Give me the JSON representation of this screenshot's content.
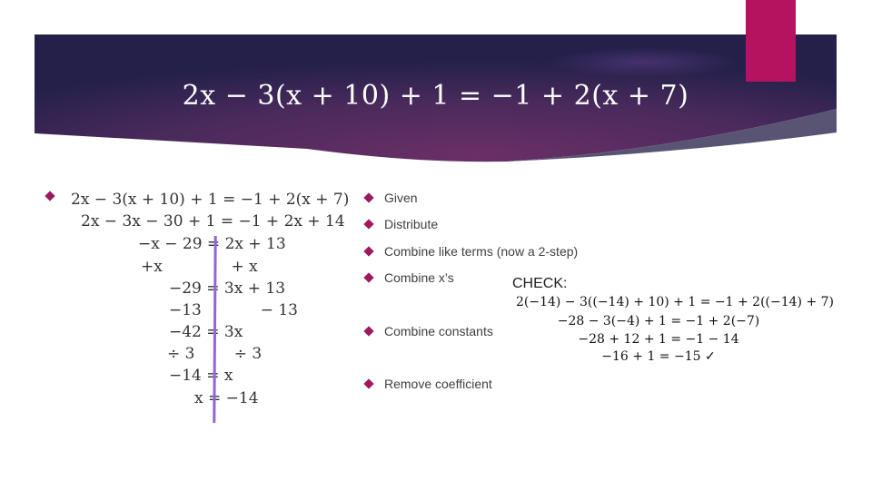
{
  "slide": {
    "title_equation": "2x − 3(x + 10) + 1 = −1 + 2(x + 7)",
    "colors": {
      "banner_dark": "#24204a",
      "banner_mid": "#6a2f66",
      "accent_magenta": "#b5135f",
      "bullet": "#9b1b5e",
      "divider_line": "#9066d6",
      "banner_swoosh": "#5a5474"
    },
    "work_steps": [
      "2x − 3(x + 10) + 1 = −1 + 2(x + 7)",
      "2x − 3x − 30 + 1 = −1 + 2x + 14",
      "−x − 29 = 2x + 13",
      "+x              + x",
      "−29 = 3x + 13",
      "−13            − 13",
      "−42 = 3x",
      "÷ 3        ÷ 3",
      "−14 = x",
      "x = −14"
    ],
    "step_labels": [
      "Given",
      "Distribute",
      "Combine like terms (now a 2-step)",
      "Combine x’s",
      "Combine constants",
      "Remove coefficient"
    ],
    "check": {
      "title": "CHECK:",
      "lines": [
        "2(−14) − 3((−14) + 10) + 1 = −1 + 2((−14) + 7)",
        "−28 − 3(−4) + 1 = −1 + 2(−7)",
        "−28 + 12 + 1 = −1 − 14",
        "−16 + 1 = −15 ✓"
      ]
    }
  }
}
